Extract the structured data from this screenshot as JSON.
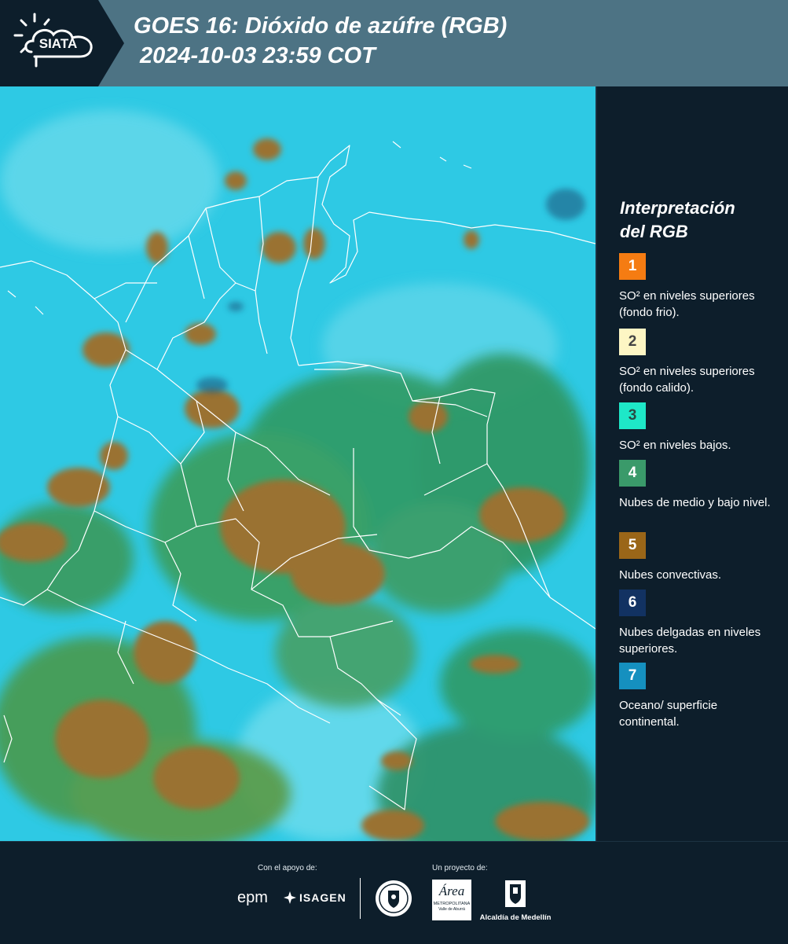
{
  "header": {
    "logo_text": "SIATA",
    "title_line1": "GOES 16: Dióxido de azúfre (RGB)",
    "title_line2": "2024-10-03 23:59 COT"
  },
  "legend": {
    "title_line1": "Interpretación",
    "title_line2": "del RGB",
    "items": [
      {
        "number": "1",
        "color": "#f57c12",
        "text_color": "#ffffff",
        "label": "SO² en niveles superiores (fondo frio)."
      },
      {
        "number": "2",
        "color": "#fdf6c4",
        "text_color": "#444444",
        "label": "SO² en niveles superiores (fondo calido)."
      },
      {
        "number": "3",
        "color": "#1ee8c8",
        "text_color": "#2a4a44",
        "label": "SO² en niveles bajos."
      },
      {
        "number": "4",
        "color": "#3a9a6a",
        "text_color": "#ffffff",
        "label": "Nubes de medio y bajo nivel."
      },
      {
        "number": "5",
        "color": "#9a6618",
        "text_color": "#ffffff",
        "label": "Nubes convectivas."
      },
      {
        "number": "6",
        "color": "#123262",
        "text_color": "#ffffff",
        "label": "Nubes delgadas en niveles superiores."
      },
      {
        "number": "7",
        "color": "#1590bf",
        "text_color": "#ffffff",
        "label": "Oceano/ superficie continental."
      }
    ]
  },
  "footer": {
    "support_label": "Con el apoyo de:",
    "project_label": "Un proyecto de:",
    "epm": "epm",
    "isagen": "ISAGEN",
    "area_main": "Área",
    "area_sub1": "METROPOLITANA",
    "area_sub2": "Valle de Aburrá",
    "alcaldia": "Alcaldía de Medellín"
  }
}
